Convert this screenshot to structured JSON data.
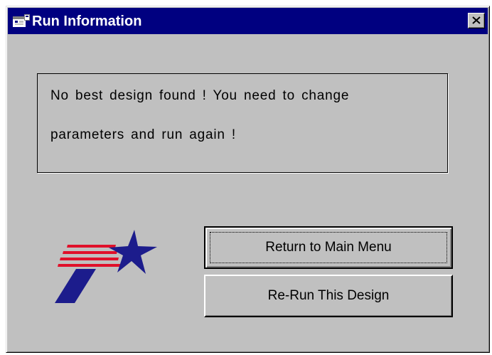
{
  "window": {
    "title": "Run Information",
    "close_symbol": "close-icon"
  },
  "message": {
    "line1": "No best design found !  You need to change",
    "line2": "parameters and run again !"
  },
  "buttons": {
    "return_label": "Return to Main Menu",
    "rerun_label": "Re-Run This Design"
  },
  "colors": {
    "title_bar": "#000080",
    "dialog_face": "#c0c0c0",
    "logo_red": "#e0102a",
    "logo_blue": "#1c1c8c"
  }
}
